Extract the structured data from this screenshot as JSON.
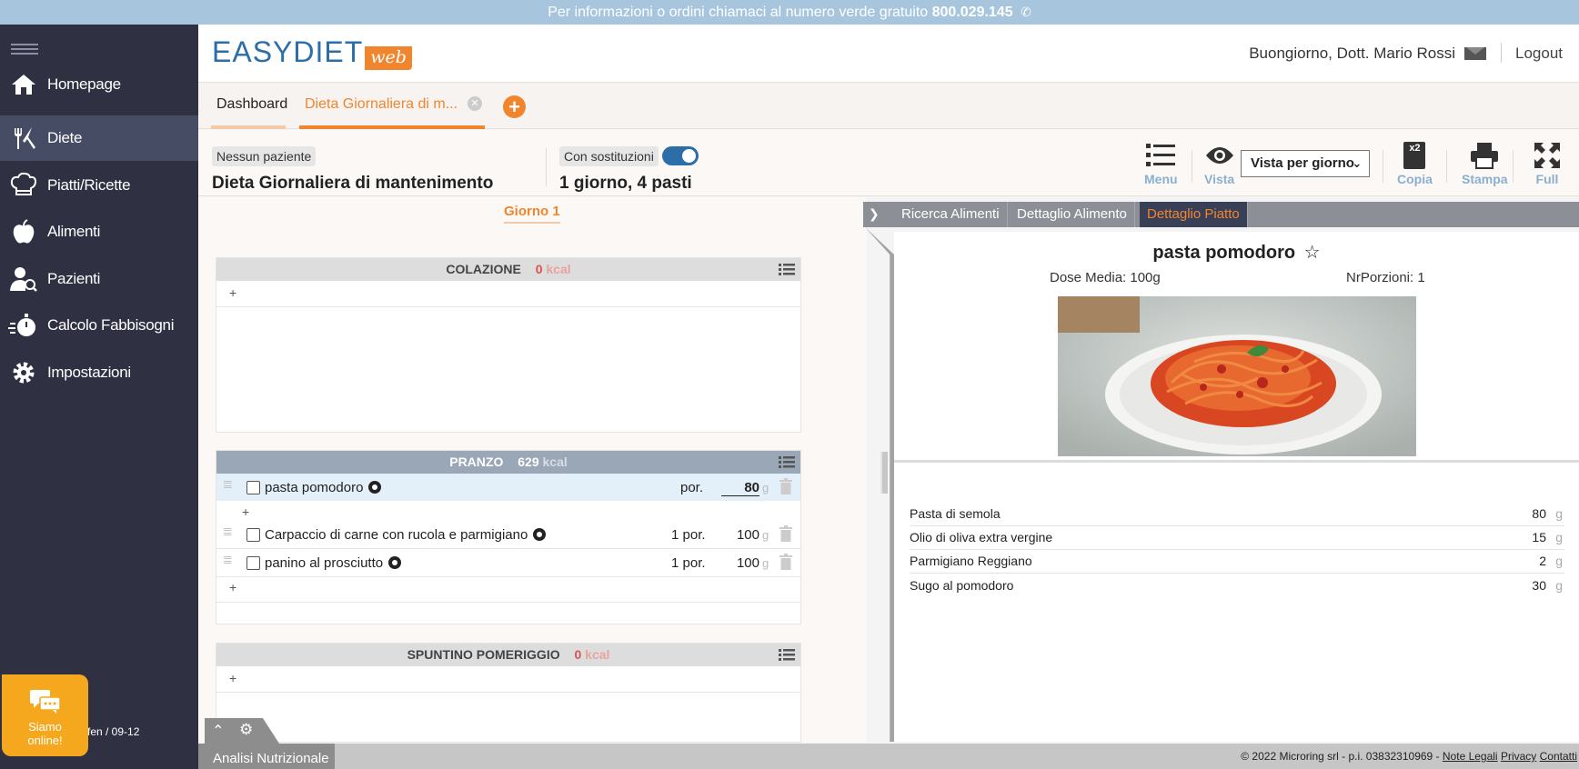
{
  "topbar": {
    "text": "Per informazioni o ordini chiamaci al numero verde gratuito",
    "phone_number": "800.029.145"
  },
  "sidebar": {
    "items": [
      {
        "label": "Homepage",
        "icon": "home-icon",
        "active": false
      },
      {
        "label": "Diete",
        "icon": "fork-knife-icon",
        "active": true
      },
      {
        "label": "Piatti/Ricette",
        "icon": "chef-hat-icon",
        "active": false
      },
      {
        "label": "Alimenti",
        "icon": "apple-icon",
        "active": false
      },
      {
        "label": "Pazienti",
        "icon": "patient-search-icon",
        "active": false
      },
      {
        "label": "Calcolo Fabbisogni",
        "icon": "stopwatch-icon",
        "active": false
      },
      {
        "label": "Impostazioni",
        "icon": "gear-icon",
        "active": false
      }
    ],
    "footer": "fen / 09-12",
    "chat": {
      "line1": "Siamo",
      "line2": "online!"
    }
  },
  "header": {
    "logo_main": "EASYDIET",
    "logo_sub": "web",
    "greeting": "Buongiorno, Dott. Mario Rossi",
    "logout": "Logout"
  },
  "tabs": [
    {
      "label": "Dashboard"
    },
    {
      "label": "Dieta Giornaliera di m..."
    }
  ],
  "info": {
    "patient_pill": "Nessun paziente",
    "diet_title": "Dieta Giornaliera di mantenimento",
    "substitutions_pill": "Con sostituzioni",
    "substitutions_on": true,
    "days_meals": "1 giorno, 4 pasti"
  },
  "toolbar": {
    "menu": "Menu",
    "vista": "Vista",
    "view_select": "Vista per giorno",
    "copy_badge": "x2",
    "copia": "Copia",
    "stampa": "Stampa",
    "full": "Full"
  },
  "day_tab": "Giorno 1",
  "meals": {
    "colazione": {
      "name": "COLAZIONE",
      "kcal": "0",
      "unit": "kcal"
    },
    "pranzo": {
      "name": "PRANZO",
      "kcal": "629",
      "unit": "kcal",
      "items": [
        {
          "name": "pasta pomodoro",
          "portion": "por.",
          "qty": "80",
          "unit": "g"
        },
        {
          "name": "Carpaccio di carne con rucola e parmigiano",
          "portion": "1 por.",
          "qty": "100",
          "unit": "g"
        },
        {
          "name": "panino al prosciutto",
          "portion": "1 por.",
          "qty": "100",
          "unit": "g"
        }
      ]
    },
    "spuntino": {
      "name": "SPUNTINO POMERIGGIO",
      "kcal": "0",
      "unit": "kcal"
    },
    "add_symbol": "+"
  },
  "right_panel": {
    "tabs": [
      "Ricerca Alimenti",
      "Dettaglio Alimento",
      "Dettaglio Piatto"
    ],
    "active_tab": 2,
    "dish_title": "pasta pomodoro",
    "dose": "Dose Media: 100g",
    "portions": "NrPorzioni: 1",
    "ingredients": [
      {
        "name": "Pasta di semola",
        "qty": "80",
        "unit": "g"
      },
      {
        "name": "Olio di oliva extra vergine",
        "qty": "15",
        "unit": "g"
      },
      {
        "name": "Parmigiano Reggiano",
        "qty": "2",
        "unit": "g"
      },
      {
        "name": "Sugo al pomodoro",
        "qty": "30",
        "unit": "g"
      }
    ]
  },
  "bottom": {
    "analisi": "Analisi Nutrizionale",
    "copyright": "© 2022 Microring srl - p.i. 03832310969 -",
    "note_legali": "Note Legali",
    "privacy": "Privacy",
    "contatti": "Contatti"
  },
  "colors": {
    "accent": "#f0852e",
    "brand_blue": "#2b6ea8",
    "sidebar_bg": "#2f3142",
    "kcal_red": "#d9534f"
  }
}
